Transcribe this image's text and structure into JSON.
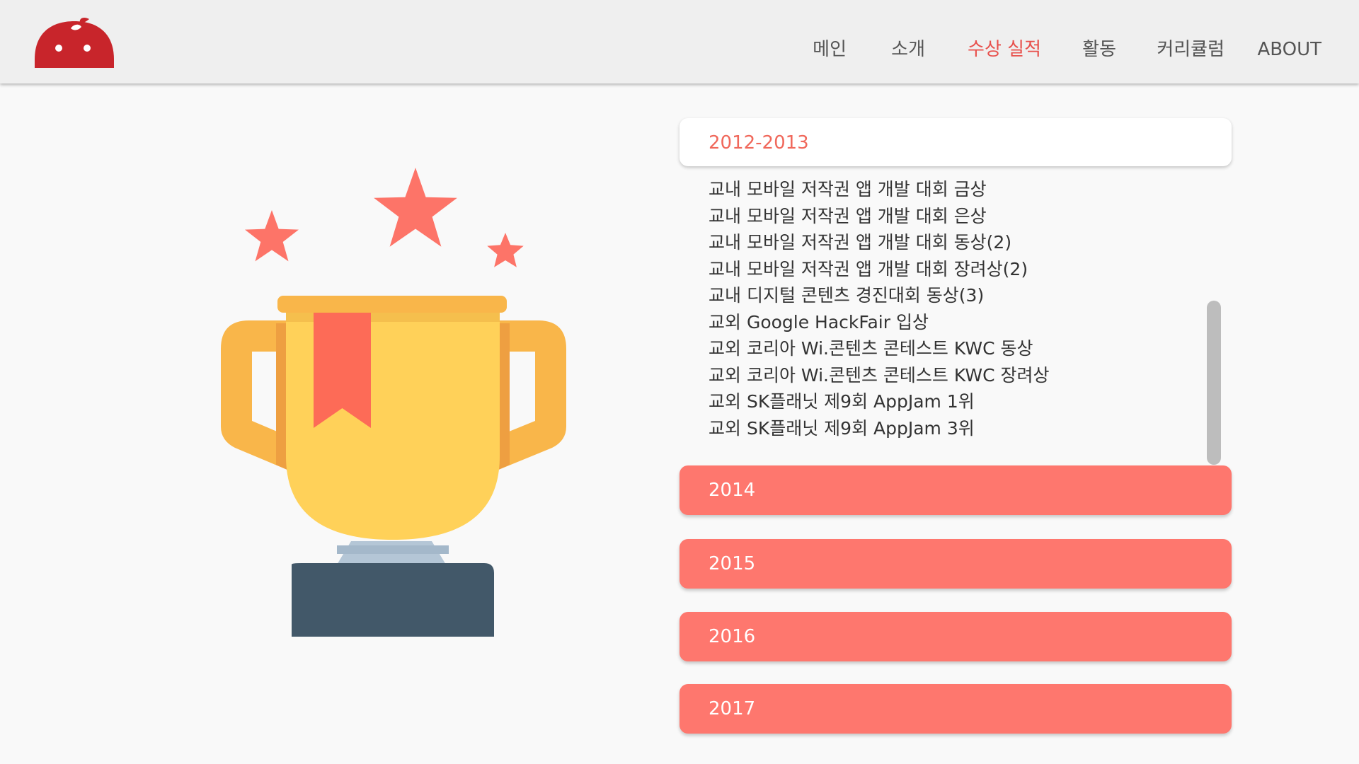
{
  "header": {
    "nav": [
      {
        "label": "메인",
        "active": false
      },
      {
        "label": "소개",
        "active": false
      },
      {
        "label": "수상 실적",
        "active": true
      },
      {
        "label": "활동",
        "active": false
      },
      {
        "label": "커리큘럼",
        "active": false
      },
      {
        "label": "ABOUT",
        "active": false
      }
    ]
  },
  "colors": {
    "accent": "#e8504c",
    "accordion_closed": "#fe776e",
    "open_title": "#f0685b",
    "header_bg": "#efefef",
    "logo": "#c8252b"
  },
  "illustration": {
    "icon": "trophy-with-stars-icon"
  },
  "accordion": {
    "open": {
      "title": "2012-2013",
      "items": [
        "교내 모바일 저작권 앱 개발 대회 금상",
        "교내 모바일 저작권 앱 개발 대회 은상",
        "교내 모바일 저작권 앱 개발 대회 동상(2)",
        "교내 모바일 저작권 앱 개발 대회 장려상(2)",
        "교내 디지털 콘텐츠 경진대회 동상(3)",
        "교외 Google HackFair 입상",
        "교외 코리아 Wi.콘텐츠 콘테스트 KWC 동상",
        "교외 코리아 Wi.콘텐츠 콘테스트 KWC 장려상",
        "교외 SK플래닛 제9회 AppJam 1위",
        "교외 SK플래닛 제9회 AppJam 3위"
      ]
    },
    "closed": [
      {
        "title": "2014"
      },
      {
        "title": "2015"
      },
      {
        "title": "2016"
      },
      {
        "title": "2017"
      }
    ]
  }
}
